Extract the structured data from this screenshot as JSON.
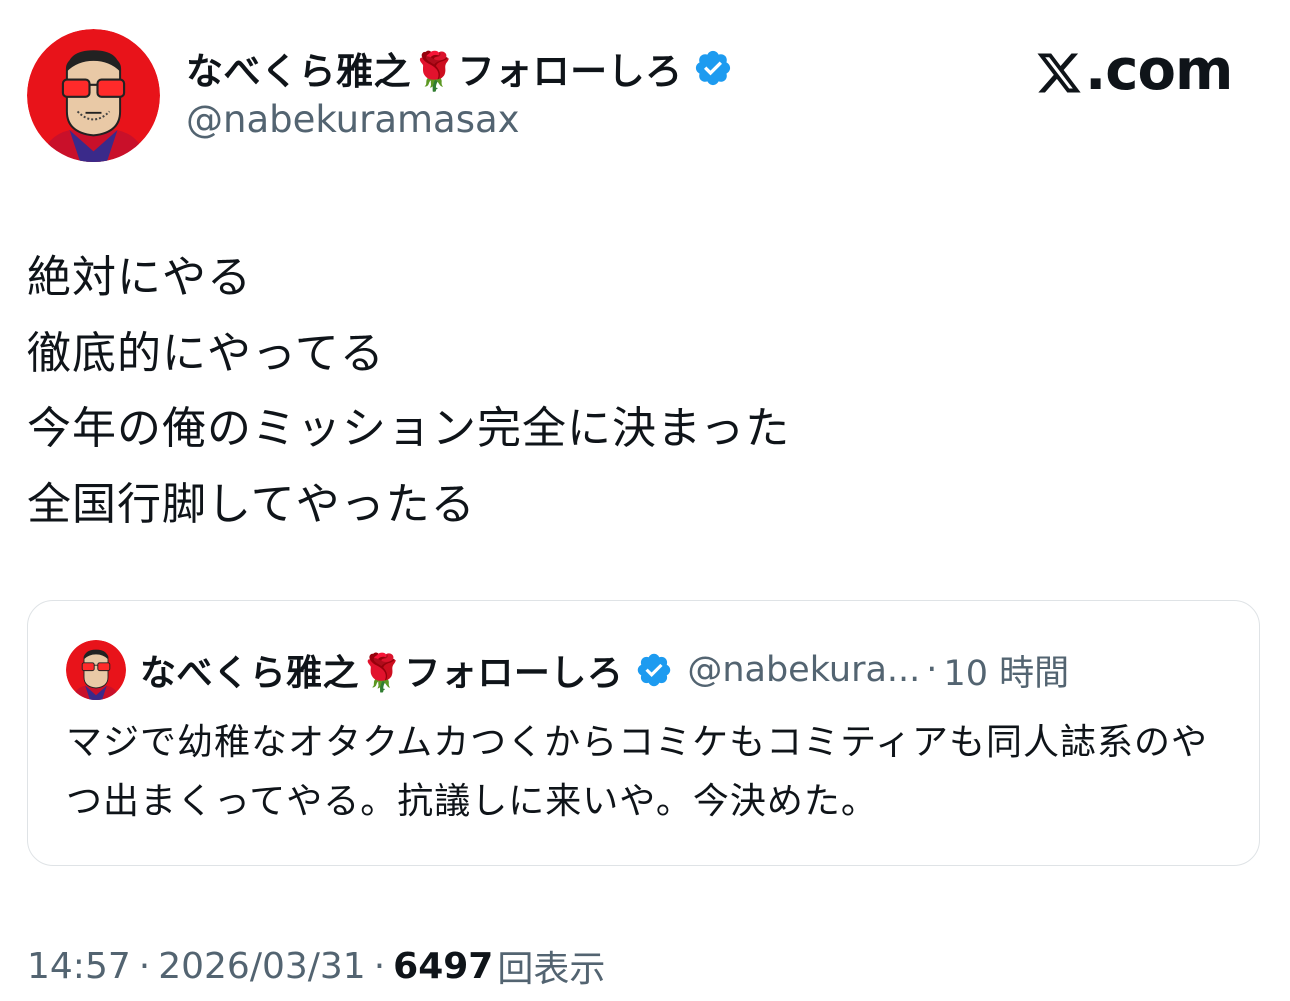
{
  "author": {
    "display_name": "なべくら雅之🌹フォローしろ",
    "handle": "@nabekuramasax",
    "verified": true
  },
  "brand": {
    "logo_text": ".com",
    "logo_icon": "x-logo-icon"
  },
  "tweet": {
    "lines": [
      "絶対にやる",
      "徹底的にやってる",
      "今年の俺のミッション完全に決まった",
      "全国行脚してやったる"
    ]
  },
  "quote": {
    "display_name": "なべくら雅之🌹フォローしろ",
    "handle": "@nabekura...",
    "separator": "·",
    "time": "10 時間",
    "body": "マジで幼稚なオタクムカつくからコミケもコミティアも同人誌系のやつ出まくってやる。抗議しに来いや。今決めた。"
  },
  "meta": {
    "time": "14:57",
    "date": "2026/03/31",
    "separator": "·",
    "views_count": "6497",
    "views_label": "回表示"
  },
  "colors": {
    "text": "#0f1419",
    "secondary": "#536471",
    "verified": "#1d9bf0",
    "border": "#dfe3e6",
    "avatar_bg": "#e8131a"
  }
}
